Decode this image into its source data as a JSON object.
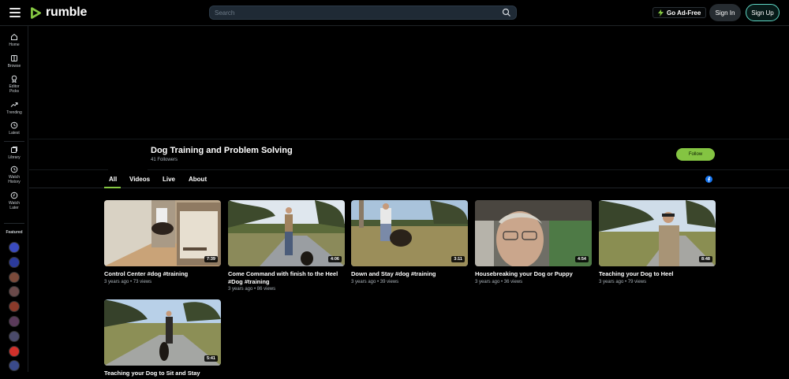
{
  "header": {
    "logo_text": "rumble",
    "search_placeholder": "Search",
    "ad_free_label": "Go Ad-Free",
    "sign_in_label": "Sign In",
    "sign_up_label": "Sign Up"
  },
  "sidebar": {
    "items": [
      {
        "label": "Home",
        "icon": "home-icon"
      },
      {
        "label": "Browse",
        "icon": "browse-icon"
      },
      {
        "label": "Editor Picks",
        "icon": "editor-picks-icon"
      },
      {
        "label": "Trending",
        "icon": "trending-icon"
      },
      {
        "label": "Latest",
        "icon": "clock-icon"
      },
      {
        "label": "Library",
        "icon": "library-icon"
      },
      {
        "label": "Watch History",
        "icon": "history-icon"
      },
      {
        "label": "Watch Later",
        "icon": "watch-later-icon"
      }
    ],
    "featured_label": "Featured",
    "featured_colors": [
      "#3a4bbf",
      "#2b3a9a",
      "#7a4a3a",
      "#6a4a4a",
      "#8a3a2a",
      "#5a3a5a",
      "#4a4a6a",
      "#d0302a",
      "#3a4a8a"
    ]
  },
  "channel": {
    "title": "Dog Training and Problem Solving",
    "followers": "41 Followers",
    "follow_label": "Follow"
  },
  "tabs": [
    {
      "label": "All",
      "active": true
    },
    {
      "label": "Videos",
      "active": false
    },
    {
      "label": "Live",
      "active": false
    },
    {
      "label": "About",
      "active": false
    }
  ],
  "videos": [
    {
      "title": "Control Center #dog #training",
      "meta": "3 years ago • 73 views",
      "duration": "7:39"
    },
    {
      "title": "Come Command with finish to the Heel #Dog #training",
      "meta": "3 years ago • 86 views",
      "duration": "4:06"
    },
    {
      "title": "Down and Stay #dog #training",
      "meta": "3 years ago • 39 views",
      "duration": "3:11"
    },
    {
      "title": "Housebreaking your Dog or Puppy",
      "meta": "3 years ago • 36 views",
      "duration": "4:54"
    },
    {
      "title": "Teaching your Dog to Heel",
      "meta": "3 years ago • 79 views",
      "duration": "8:48"
    },
    {
      "title": "Teaching your Dog to Sit and Stay",
      "meta": "",
      "duration": "5:41"
    }
  ]
}
